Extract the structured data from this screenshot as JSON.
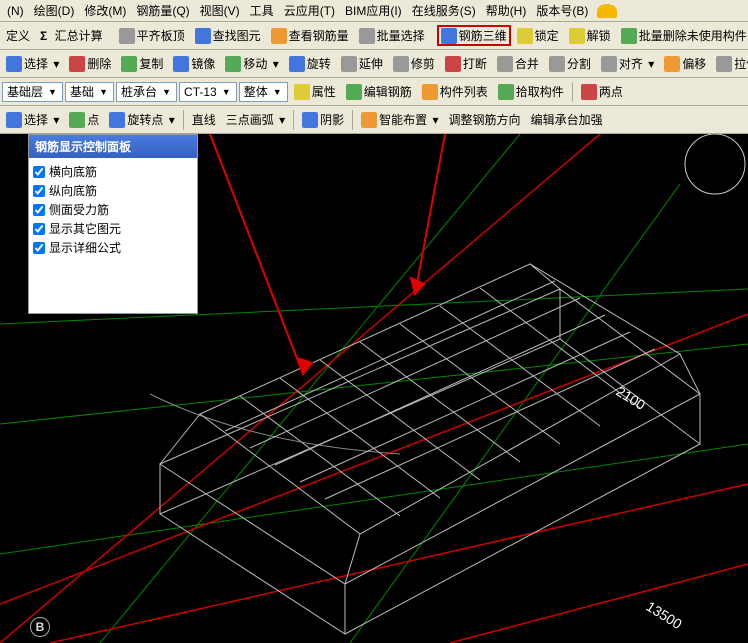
{
  "menubar": {
    "items": [
      "(N)",
      "绘图(D)",
      "修改(M)",
      "钢筋量(Q)",
      "视图(V)",
      "工具",
      "云应用(T)",
      "BIM应用(I)",
      "在线服务(S)",
      "帮助(H)",
      "版本号(B)"
    ]
  },
  "toolbar1": {
    "define": "定义",
    "sum": "汇总计算",
    "flat": "平齐板顶",
    "findElem": "查找图元",
    "viewRebar": "查看钢筋量",
    "batchSel": "批量选择",
    "rebar3d": "钢筋三维",
    "lock": "锁定",
    "unlock": "解锁",
    "batchDel": "批量删除未使用构件"
  },
  "toolbar2": {
    "select": "选择",
    "del": "删除",
    "copy": "复制",
    "mirror": "镜像",
    "move": "移动",
    "rotate": "旋转",
    "extend": "延伸",
    "trim": "修剪",
    "break": "打断",
    "merge": "合并",
    "split": "分割",
    "align": "对齐",
    "offset": "偏移",
    "stretch": "拉伸"
  },
  "toolbar3": {
    "layer": "基础层",
    "category": "基础",
    "subtype": "桩承台",
    "code": "CT-13",
    "scope": "整体",
    "props": "属性",
    "editRebar": "编辑钢筋",
    "memberList": "构件列表",
    "pickMember": "拾取构件",
    "twoPoint": "两点"
  },
  "toolbar4": {
    "select": "选择",
    "point": "点",
    "rotatePoint": "旋转点",
    "linePoint": "直线",
    "threePointArc": "三点画弧",
    "shadow": "阴影",
    "smartLayout": "智能布置",
    "adjustDir": "调整钢筋方向",
    "editCapReinf": "编辑承台加强"
  },
  "panel": {
    "title": "钢筋显示控制面板",
    "items": [
      {
        "label": "横向底筋",
        "checked": true
      },
      {
        "label": "纵向底筋",
        "checked": true
      },
      {
        "label": "侧面受力筋",
        "checked": true
      },
      {
        "label": "显示其它图元",
        "checked": true
      },
      {
        "label": "显示详细公式",
        "checked": true
      }
    ]
  },
  "dims": {
    "d1": "2100",
    "d2": "13500"
  },
  "badge": "B"
}
